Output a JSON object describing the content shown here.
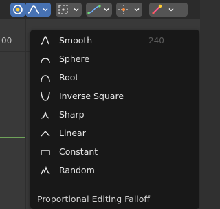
{
  "header": {
    "ruler_left": "00",
    "ruler_right": "240"
  },
  "menu": {
    "title": "Proportional Editing Falloff",
    "items": [
      {
        "label": "Smooth",
        "icon": "smooth-falloff-icon"
      },
      {
        "label": "Sphere",
        "icon": "sphere-falloff-icon"
      },
      {
        "label": "Root",
        "icon": "root-falloff-icon"
      },
      {
        "label": "Inverse Square",
        "icon": "inverse-square-falloff-icon"
      },
      {
        "label": "Sharp",
        "icon": "sharp-falloff-icon"
      },
      {
        "label": "Linear",
        "icon": "linear-falloff-icon"
      },
      {
        "label": "Constant",
        "icon": "constant-falloff-icon"
      },
      {
        "label": "Random",
        "icon": "random-falloff-icon"
      }
    ]
  },
  "colors": {
    "accent": "#4772b3",
    "menu_bg": "#181818",
    "text": "#e6e6e6"
  }
}
